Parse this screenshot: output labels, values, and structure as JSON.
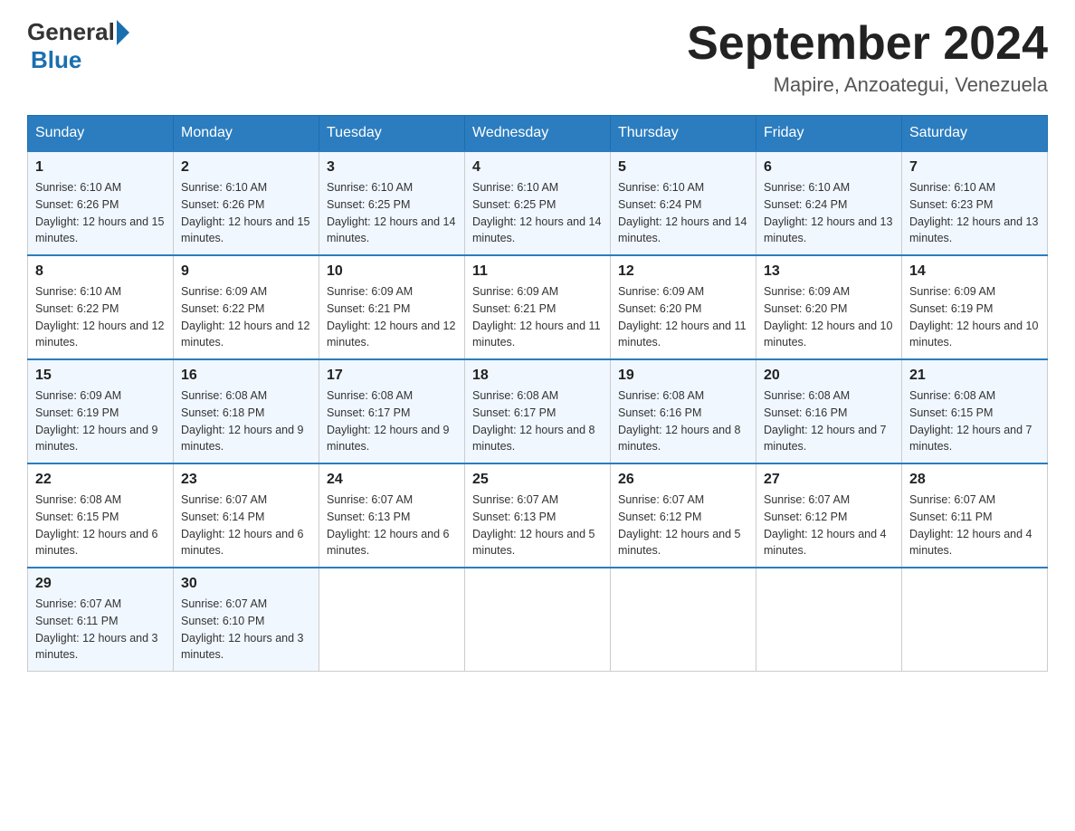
{
  "header": {
    "logo": {
      "text_general": "General",
      "text_blue": "Blue"
    },
    "title": "September 2024",
    "location": "Mapire, Anzoategui, Venezuela"
  },
  "weekdays": [
    "Sunday",
    "Monday",
    "Tuesday",
    "Wednesday",
    "Thursday",
    "Friday",
    "Saturday"
  ],
  "weeks": [
    [
      {
        "day": "1",
        "sunrise": "Sunrise: 6:10 AM",
        "sunset": "Sunset: 6:26 PM",
        "daylight": "Daylight: 12 hours and 15 minutes."
      },
      {
        "day": "2",
        "sunrise": "Sunrise: 6:10 AM",
        "sunset": "Sunset: 6:26 PM",
        "daylight": "Daylight: 12 hours and 15 minutes."
      },
      {
        "day": "3",
        "sunrise": "Sunrise: 6:10 AM",
        "sunset": "Sunset: 6:25 PM",
        "daylight": "Daylight: 12 hours and 14 minutes."
      },
      {
        "day": "4",
        "sunrise": "Sunrise: 6:10 AM",
        "sunset": "Sunset: 6:25 PM",
        "daylight": "Daylight: 12 hours and 14 minutes."
      },
      {
        "day": "5",
        "sunrise": "Sunrise: 6:10 AM",
        "sunset": "Sunset: 6:24 PM",
        "daylight": "Daylight: 12 hours and 14 minutes."
      },
      {
        "day": "6",
        "sunrise": "Sunrise: 6:10 AM",
        "sunset": "Sunset: 6:24 PM",
        "daylight": "Daylight: 12 hours and 13 minutes."
      },
      {
        "day": "7",
        "sunrise": "Sunrise: 6:10 AM",
        "sunset": "Sunset: 6:23 PM",
        "daylight": "Daylight: 12 hours and 13 minutes."
      }
    ],
    [
      {
        "day": "8",
        "sunrise": "Sunrise: 6:10 AM",
        "sunset": "Sunset: 6:22 PM",
        "daylight": "Daylight: 12 hours and 12 minutes."
      },
      {
        "day": "9",
        "sunrise": "Sunrise: 6:09 AM",
        "sunset": "Sunset: 6:22 PM",
        "daylight": "Daylight: 12 hours and 12 minutes."
      },
      {
        "day": "10",
        "sunrise": "Sunrise: 6:09 AM",
        "sunset": "Sunset: 6:21 PM",
        "daylight": "Daylight: 12 hours and 12 minutes."
      },
      {
        "day": "11",
        "sunrise": "Sunrise: 6:09 AM",
        "sunset": "Sunset: 6:21 PM",
        "daylight": "Daylight: 12 hours and 11 minutes."
      },
      {
        "day": "12",
        "sunrise": "Sunrise: 6:09 AM",
        "sunset": "Sunset: 6:20 PM",
        "daylight": "Daylight: 12 hours and 11 minutes."
      },
      {
        "day": "13",
        "sunrise": "Sunrise: 6:09 AM",
        "sunset": "Sunset: 6:20 PM",
        "daylight": "Daylight: 12 hours and 10 minutes."
      },
      {
        "day": "14",
        "sunrise": "Sunrise: 6:09 AM",
        "sunset": "Sunset: 6:19 PM",
        "daylight": "Daylight: 12 hours and 10 minutes."
      }
    ],
    [
      {
        "day": "15",
        "sunrise": "Sunrise: 6:09 AM",
        "sunset": "Sunset: 6:19 PM",
        "daylight": "Daylight: 12 hours and 9 minutes."
      },
      {
        "day": "16",
        "sunrise": "Sunrise: 6:08 AM",
        "sunset": "Sunset: 6:18 PM",
        "daylight": "Daylight: 12 hours and 9 minutes."
      },
      {
        "day": "17",
        "sunrise": "Sunrise: 6:08 AM",
        "sunset": "Sunset: 6:17 PM",
        "daylight": "Daylight: 12 hours and 9 minutes."
      },
      {
        "day": "18",
        "sunrise": "Sunrise: 6:08 AM",
        "sunset": "Sunset: 6:17 PM",
        "daylight": "Daylight: 12 hours and 8 minutes."
      },
      {
        "day": "19",
        "sunrise": "Sunrise: 6:08 AM",
        "sunset": "Sunset: 6:16 PM",
        "daylight": "Daylight: 12 hours and 8 minutes."
      },
      {
        "day": "20",
        "sunrise": "Sunrise: 6:08 AM",
        "sunset": "Sunset: 6:16 PM",
        "daylight": "Daylight: 12 hours and 7 minutes."
      },
      {
        "day": "21",
        "sunrise": "Sunrise: 6:08 AM",
        "sunset": "Sunset: 6:15 PM",
        "daylight": "Daylight: 12 hours and 7 minutes."
      }
    ],
    [
      {
        "day": "22",
        "sunrise": "Sunrise: 6:08 AM",
        "sunset": "Sunset: 6:15 PM",
        "daylight": "Daylight: 12 hours and 6 minutes."
      },
      {
        "day": "23",
        "sunrise": "Sunrise: 6:07 AM",
        "sunset": "Sunset: 6:14 PM",
        "daylight": "Daylight: 12 hours and 6 minutes."
      },
      {
        "day": "24",
        "sunrise": "Sunrise: 6:07 AM",
        "sunset": "Sunset: 6:13 PM",
        "daylight": "Daylight: 12 hours and 6 minutes."
      },
      {
        "day": "25",
        "sunrise": "Sunrise: 6:07 AM",
        "sunset": "Sunset: 6:13 PM",
        "daylight": "Daylight: 12 hours and 5 minutes."
      },
      {
        "day": "26",
        "sunrise": "Sunrise: 6:07 AM",
        "sunset": "Sunset: 6:12 PM",
        "daylight": "Daylight: 12 hours and 5 minutes."
      },
      {
        "day": "27",
        "sunrise": "Sunrise: 6:07 AM",
        "sunset": "Sunset: 6:12 PM",
        "daylight": "Daylight: 12 hours and 4 minutes."
      },
      {
        "day": "28",
        "sunrise": "Sunrise: 6:07 AM",
        "sunset": "Sunset: 6:11 PM",
        "daylight": "Daylight: 12 hours and 4 minutes."
      }
    ],
    [
      {
        "day": "29",
        "sunrise": "Sunrise: 6:07 AM",
        "sunset": "Sunset: 6:11 PM",
        "daylight": "Daylight: 12 hours and 3 minutes."
      },
      {
        "day": "30",
        "sunrise": "Sunrise: 6:07 AM",
        "sunset": "Sunset: 6:10 PM",
        "daylight": "Daylight: 12 hours and 3 minutes."
      },
      null,
      null,
      null,
      null,
      null
    ]
  ]
}
